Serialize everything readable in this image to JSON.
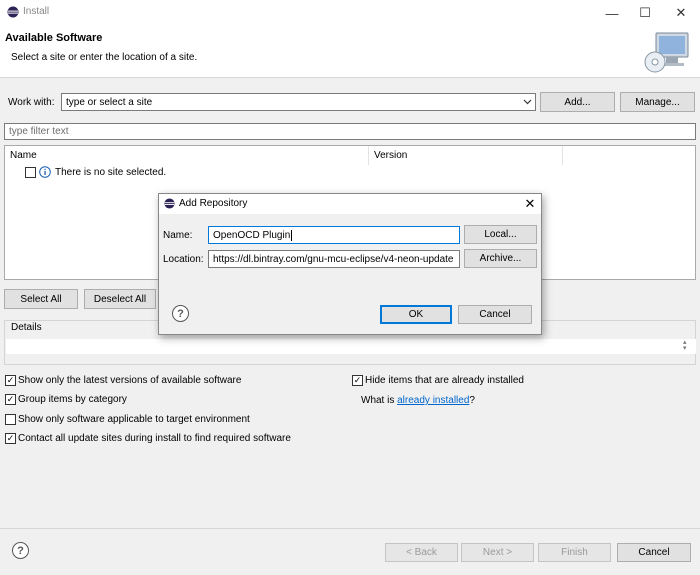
{
  "window": {
    "title": "Install",
    "controls": {
      "minimize": "—",
      "maximize": "☐",
      "close": "✕"
    }
  },
  "header": {
    "title": "Available Software",
    "subtitle": "Select a site or enter the location of a site."
  },
  "work_with": {
    "label": "Work with:",
    "value": "type or select a site",
    "add_button": "Add...",
    "manage_button": "Manage..."
  },
  "filter": {
    "placeholder": "type filter text"
  },
  "table": {
    "columns": [
      "Name",
      "Version"
    ],
    "empty_message": "There is no site selected."
  },
  "selection_buttons": {
    "select_all": "Select All",
    "deselect_all": "Deselect All"
  },
  "details": {
    "label": "Details"
  },
  "options": {
    "left": [
      {
        "label": "Show only the latest versions of available software",
        "checked": true
      },
      {
        "label": "Group items by category",
        "checked": true
      },
      {
        "label": "Show only software applicable to target environment",
        "checked": false
      },
      {
        "label": "Contact all update sites during install to find required software",
        "checked": true
      }
    ],
    "hide_installed": {
      "label": "Hide items that are already installed",
      "checked": true
    },
    "what_is": {
      "prefix": "What is ",
      "link": "already installed",
      "suffix": "?"
    }
  },
  "footer": {
    "back": "< Back",
    "next": "Next >",
    "finish": "Finish",
    "cancel": "Cancel"
  },
  "dialog": {
    "title": "Add Repository",
    "name_label": "Name:",
    "name_value": "OpenOCD Plugin",
    "location_label": "Location:",
    "location_value": "https://dl.bintray.com/gnu-mcu-eclipse/v4-neon-update",
    "local_button": "Local...",
    "archive_button": "Archive...",
    "ok_button": "OK",
    "cancel_button": "Cancel"
  },
  "colors": {
    "accent": "#0078d7",
    "link": "#0066cc",
    "info_icon": "#1a5fb4"
  }
}
